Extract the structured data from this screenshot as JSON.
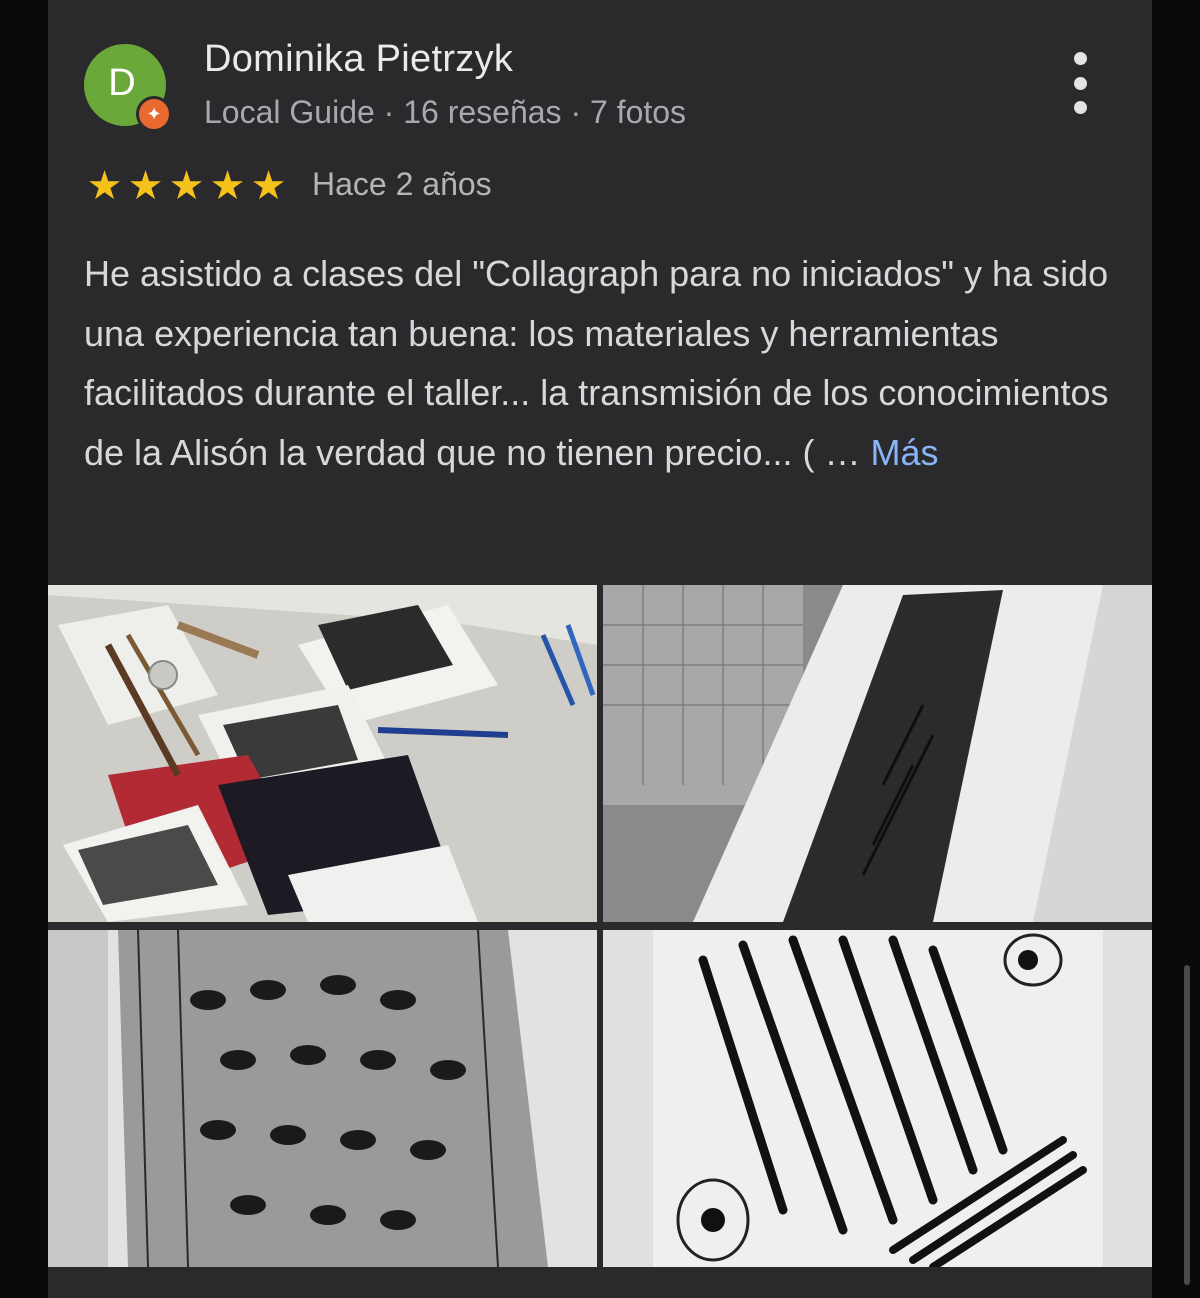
{
  "review": {
    "author": {
      "initial": "D",
      "name": "Dominika Pietrzyk",
      "meta": "Local Guide · 16 reseñas · 7 fotos",
      "avatar_color": "#6aa83a",
      "badge_color": "#e86a2e"
    },
    "rating": 5,
    "date": "Hace 2 años",
    "text": "He asistido a clases del \"Collagraph para no iniciados\" y ha sido una experiencia tan buena: los materiales y herramientas facilitados durante el taller... la transmisión de los conocimientos de la Alisón la verdad que no tienen precio... ( … ",
    "more_label": "Más",
    "more_link_color": "#8ab4f8",
    "star_color": "#f5c21b"
  },
  "photos": [
    {
      "subject": "workshop table with prints, brushes and pens"
    },
    {
      "subject": "vertical collagraph print with leaf pattern"
    },
    {
      "subject": "close-up of dark textured collagraph print"
    },
    {
      "subject": "print with black diagonal lines and circles"
    }
  ],
  "icons": {
    "more_options": "more-vert-icon",
    "local_guide": "local-guide-star-icon",
    "star": "star-icon"
  }
}
